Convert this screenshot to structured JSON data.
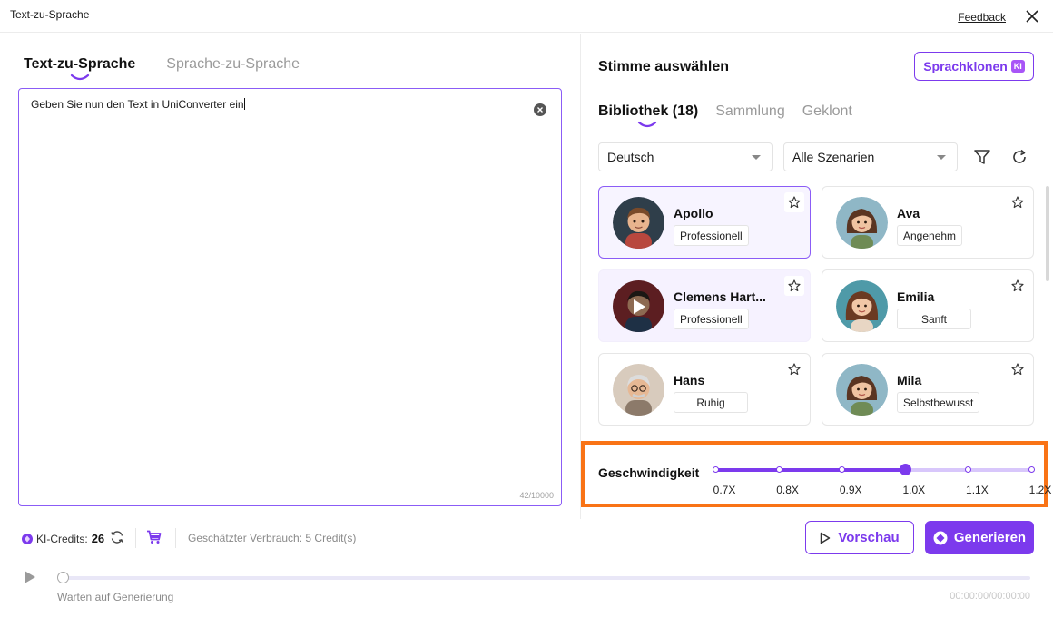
{
  "window": {
    "title": "Text-zu-Sprache",
    "feedback_label": "Feedback"
  },
  "left": {
    "tabs": [
      {
        "label": "Text-zu-Sprache",
        "active": true
      },
      {
        "label": "Sprache-zu-Sprache",
        "active": false
      }
    ],
    "text_value": "Geben Sie nun den Text in UniConverter ein",
    "char_count": "42/10000"
  },
  "right": {
    "heading": "Stimme auswählen",
    "clone_button": {
      "label": "Sprachklonen",
      "badge": "KI"
    },
    "library_tabs": [
      {
        "label": "Bibliothek (18)",
        "active": true
      },
      {
        "label": "Sammlung",
        "active": false
      },
      {
        "label": "Geklont",
        "active": false
      }
    ],
    "language_select": "Deutsch",
    "scenario_select": "Alle Szenarien",
    "voices": [
      {
        "name": "Apollo",
        "tag": "Professionell",
        "state": "selected"
      },
      {
        "name": "Ava",
        "tag": "Angenehm",
        "state": "default"
      },
      {
        "name": "Clemens Hart...",
        "tag": "Professionell",
        "state": "hovered"
      },
      {
        "name": "Emilia",
        "tag": "Sanft",
        "state": "default"
      },
      {
        "name": "Hans",
        "tag": "Ruhig",
        "state": "default"
      },
      {
        "name": "Mila",
        "tag": "Selbstbewusst",
        "state": "default"
      }
    ]
  },
  "speed": {
    "label": "Geschwindigkeit",
    "ticks": [
      "0.7X",
      "0.8X",
      "0.9X",
      "1.0X",
      "1.1X",
      "1.2X"
    ],
    "selected_index": 3
  },
  "bottom": {
    "credits_label": "KI-Credits:",
    "credits_value": "26",
    "estimate": "Geschätzter Verbrauch: 5 Credit(s)",
    "preview_label": "Vorschau",
    "generate_label": "Generieren",
    "status": "Warten auf Generierung",
    "time": "00:00:00/00:00:00"
  },
  "colors": {
    "accent": "#7c3aed",
    "highlight": "#f97316"
  }
}
